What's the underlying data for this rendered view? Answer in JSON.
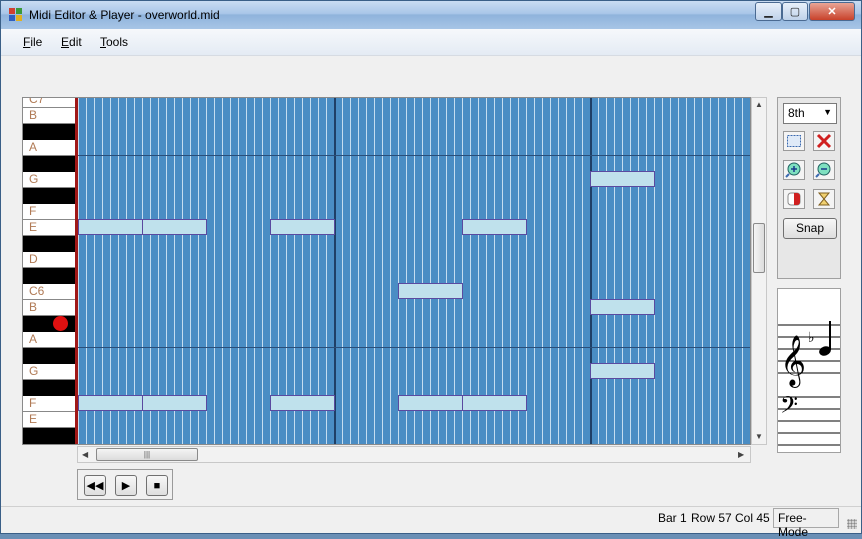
{
  "window": {
    "title": "Midi Editor & Player - overworld.mid"
  },
  "menu": [
    {
      "key": "F",
      "rest": "ile"
    },
    {
      "key": "E",
      "rest": "dit"
    },
    {
      "key": "T",
      "rest": "ools"
    }
  ],
  "keyboard": {
    "labels": [
      "C7",
      "B",
      "A",
      "G",
      "F",
      "E",
      "D",
      "C6",
      "B",
      "A",
      "G",
      "F",
      "E"
    ]
  },
  "toolbar": {
    "duration": "8th",
    "snap_label": "Snap",
    "icons": [
      "select-icon",
      "delete-icon",
      "zoom-in-icon",
      "zoom-out-icon",
      "color-icon",
      "hourglass-icon"
    ]
  },
  "staff": {
    "accidental": "♭"
  },
  "status": {
    "bar": "Bar 1",
    "row": "Row 57",
    "col": "Col 45",
    "mode": "Free-Mode"
  },
  "colors": {
    "grid_bg": "#4a8dc4",
    "note_fill": "#bfe1ec",
    "note_border": "#5a4aa0",
    "cursor_line": "#a01818",
    "recording_dot": "#e01010"
  }
}
